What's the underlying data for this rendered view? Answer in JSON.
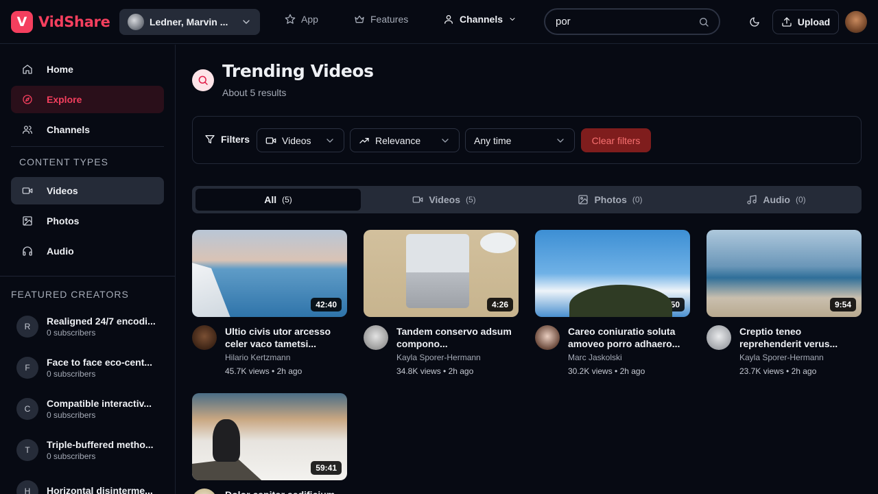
{
  "header": {
    "logo_letter": "V",
    "logo_text": "VidShare",
    "account_name": "Ledner, Marvin ...",
    "nav": [
      {
        "label": "App",
        "icon": "star-icon"
      },
      {
        "label": "Features",
        "icon": "crown-icon"
      },
      {
        "label": "Channels",
        "icon": "user-icon"
      }
    ],
    "search_value": "por",
    "upload_label": "Upload"
  },
  "sidebar": {
    "main_items": [
      {
        "label": "Home",
        "icon": "home-icon"
      },
      {
        "label": "Explore",
        "icon": "compass-icon"
      },
      {
        "label": "Channels",
        "icon": "users-icon"
      }
    ],
    "content_types_title": "CONTENT TYPES",
    "content_items": [
      {
        "label": "Videos",
        "icon": "video-icon"
      },
      {
        "label": "Photos",
        "icon": "image-icon"
      },
      {
        "label": "Audio",
        "icon": "headphones-icon"
      }
    ],
    "featured_title": "FEATURED CREATORS",
    "creators": [
      {
        "initial": "R",
        "name": "Realigned 24/7 encodi...",
        "subs": "0 subscribers"
      },
      {
        "initial": "F",
        "name": "Face to face eco-cent...",
        "subs": "0 subscribers"
      },
      {
        "initial": "C",
        "name": "Compatible interactiv...",
        "subs": "0 subscribers"
      },
      {
        "initial": "T",
        "name": "Triple-buffered metho...",
        "subs": "0 subscribers"
      },
      {
        "initial": "H",
        "name": "Horizontal disinterme...",
        "subs": ""
      }
    ]
  },
  "main": {
    "title": "Trending Videos",
    "result_count": "About 5 results",
    "filters": {
      "label": "Filters",
      "type": "Videos",
      "sort": "Relevance",
      "time": "Any time",
      "clear": "Clear filters"
    },
    "tabs": [
      {
        "label": "All",
        "count": "(5)"
      },
      {
        "label": "Videos",
        "count": "(5)"
      },
      {
        "label": "Photos",
        "count": "(0)"
      },
      {
        "label": "Audio",
        "count": "(0)"
      }
    ],
    "videos": [
      {
        "duration": "42:40",
        "title": "Ultio civis utor arcesso celer vaco tametsi...",
        "channel": "Hilario Kertzmann",
        "stats": "45.7K views • 2h ago"
      },
      {
        "duration": "4:26",
        "title": "Tandem conservo adsum compono...",
        "channel": "Kayla Sporer-Hermann",
        "stats": "34.8K views • 2h ago"
      },
      {
        "duration": "7:50",
        "title": "Careo coniuratio soluta amoveo porro adhaero...",
        "channel": "Marc Jaskolski",
        "stats": "30.2K views • 2h ago"
      },
      {
        "duration": "9:54",
        "title": "Creptio teneo reprehenderit verus...",
        "channel": "Kayla Sporer-Hermann",
        "stats": "23.7K views • 2h ago"
      },
      {
        "duration": "59:41",
        "title": "Dolor capitor aedificium...",
        "channel": "",
        "stats": ""
      }
    ]
  },
  "colors": {
    "accent": "#f43f5e",
    "background": "#070a13",
    "panel": "#252b38",
    "danger_bg": "#7f1d1d",
    "danger_text": "#f87171"
  }
}
